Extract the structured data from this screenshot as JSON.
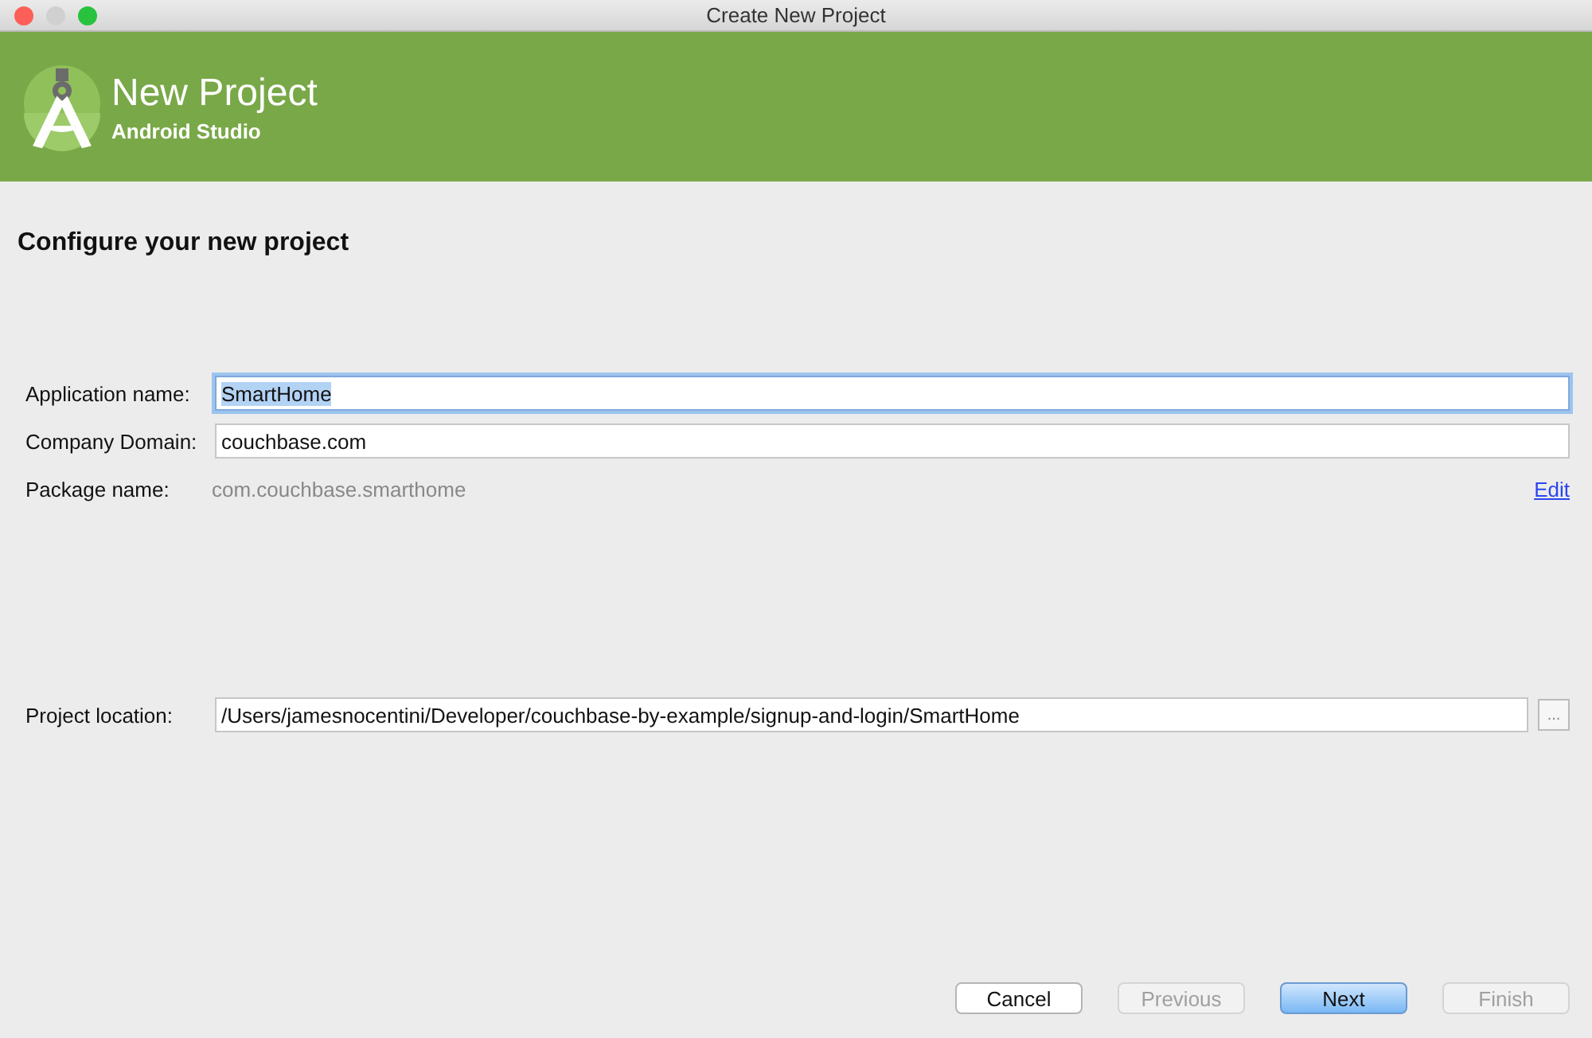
{
  "window": {
    "title": "Create New Project"
  },
  "header": {
    "title": "New Project",
    "subtitle": "Android Studio"
  },
  "heading": "Configure your new project",
  "fields": [
    {
      "label": "Application name:",
      "value": "SmartHome",
      "focused": true
    },
    {
      "label": "Company Domain:",
      "value": "couchbase.com",
      "focused": false
    }
  ],
  "package": {
    "label": "Package name:",
    "value": "com.couchbase.smarthome",
    "link": "Edit"
  },
  "location": {
    "label": "Project location:",
    "value": "/Users/jamesnocentini/Developer/couchbase-by-example/signup-and-login/SmartHome",
    "browse": "..."
  },
  "buttons": [
    {
      "label": "Cancel",
      "disabled": false,
      "default": false
    },
    {
      "label": "Previous",
      "disabled": true,
      "default": false
    },
    {
      "label": "Next",
      "disabled": false,
      "default": true
    },
    {
      "label": "Finish",
      "disabled": true,
      "default": false
    }
  ]
}
